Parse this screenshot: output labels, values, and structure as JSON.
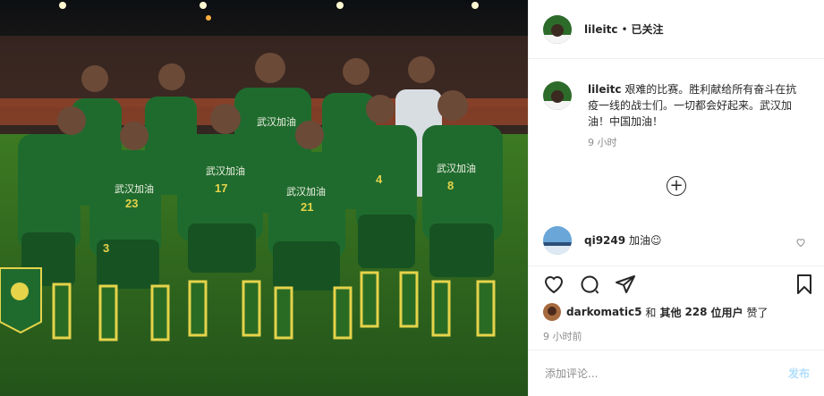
{
  "header": {
    "username": "lileitc",
    "separator": "•",
    "follow_status": "已关注"
  },
  "caption": {
    "username": "lileitc",
    "text": "艰难的比赛。胜利献给所有奋斗在抗疫一线的战士们。一切都会好起来。武汉加油！中国加油！",
    "time": "9 小时"
  },
  "load_more_icon": "plus-circle-icon",
  "comments": [
    {
      "username": "qi9249",
      "text": "加油☺"
    }
  ],
  "actions": {
    "like_icon": "heart-icon",
    "comment_icon": "comment-icon",
    "share_icon": "share-icon",
    "save_icon": "bookmark-icon"
  },
  "likes": {
    "first_user": "darkomatic5",
    "connector": "和",
    "others": "其他",
    "count": "228",
    "unit": "位用户",
    "suffix": "赞了"
  },
  "post_time": "9 小时前",
  "add_comment": {
    "placeholder": "添加评论...",
    "post_label": "发布"
  },
  "photo": {
    "banner_text": "武汉加油",
    "jersey_numbers": [
      "23",
      "17",
      "21",
      "8",
      "4",
      "3"
    ]
  },
  "colors": {
    "kit_green": "#1f6b2e",
    "pitch_green": "#2f6a1e",
    "post_button": "#b2dffc",
    "muted_text": "#8e8e8e"
  }
}
